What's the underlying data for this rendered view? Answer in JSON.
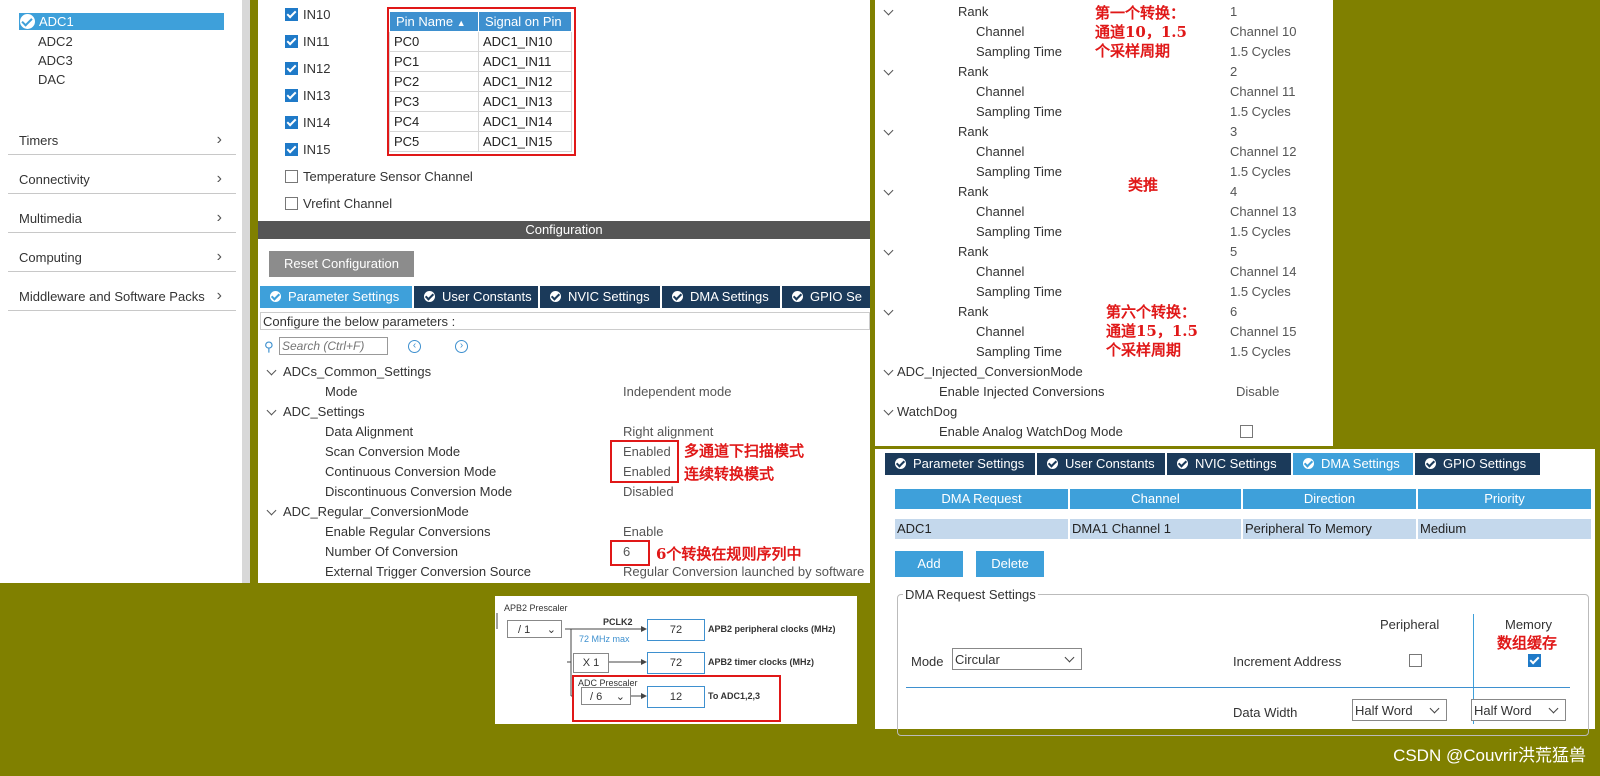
{
  "sidebar": {
    "adcs": [
      "ADC1",
      "ADC2",
      "ADC3",
      "DAC"
    ],
    "categories": [
      "Timers",
      "Connectivity",
      "Multimedia",
      "Computing",
      "Middleware and Software Packs"
    ]
  },
  "pins": {
    "channels": [
      "IN10",
      "IN11",
      "IN12",
      "IN13",
      "IN14",
      "IN15"
    ],
    "extra": [
      "Temperature Sensor Channel",
      "Vrefint Channel"
    ],
    "table_headers": [
      "Pin Name",
      "Signal on Pin"
    ],
    "rows": [
      [
        "PC0",
        "ADC1_IN10"
      ],
      [
        "PC1",
        "ADC1_IN11"
      ],
      [
        "PC2",
        "ADC1_IN12"
      ],
      [
        "PC3",
        "ADC1_IN13"
      ],
      [
        "PC4",
        "ADC1_IN14"
      ],
      [
        "PC5",
        "ADC1_IN15"
      ]
    ]
  },
  "config": {
    "bar_title": "Configuration",
    "reset_label": "Reset Configuration",
    "tabs": [
      "Parameter Settings",
      "User Constants",
      "NVIC Settings",
      "DMA Settings",
      "GPIO Se"
    ],
    "hint": "Configure the below parameters :",
    "search_placeholder": "Search (Ctrl+F)",
    "sections": [
      {
        "title": "ADCs_Common_Settings",
        "rows": [
          [
            "Mode",
            "Independent mode"
          ]
        ]
      },
      {
        "title": "ADC_Settings",
        "rows": [
          [
            "Data Alignment",
            "Right alignment"
          ],
          [
            "Scan Conversion Mode",
            "Enabled"
          ],
          [
            "Continuous Conversion Mode",
            "Enabled"
          ],
          [
            "Discontinuous Conversion Mode",
            "Disabled"
          ]
        ]
      },
      {
        "title": "ADC_Regular_ConversionMode",
        "rows": [
          [
            "Enable Regular Conversions",
            "Enable"
          ],
          [
            "Number Of Conversion",
            "6"
          ],
          [
            "External Trigger Conversion Source",
            "Regular Conversion launched by software"
          ]
        ]
      }
    ],
    "notes": {
      "scan": "多通道下扫描模式",
      "cont": "连续转换模式",
      "num": "6个转换在规则序列中"
    }
  },
  "clock": {
    "apb2_prescaler_label": "APB2 Prescaler",
    "apb2_prescaler": "/ 1",
    "pclk2": "PCLK2",
    "max_note": "72 MHz max",
    "periph_val": "72",
    "periph_label": "APB2 peripheral clocks (MHz)",
    "x1": "X 1",
    "timer_val": "72",
    "timer_label": "APB2 timer clocks (MHz)",
    "adc_prescaler_label": "ADC Prescaler",
    "adc_prescaler": "/ 6",
    "adc_val": "12",
    "adc_label": "To ADC1,2,3"
  },
  "ranks": {
    "items": [
      {
        "rank": "1",
        "channel": "Channel 10",
        "sampling": "1.5 Cycles"
      },
      {
        "rank": "2",
        "channel": "Channel 11",
        "sampling": "1.5 Cycles"
      },
      {
        "rank": "3",
        "channel": "Channel 12",
        "sampling": "1.5 Cycles"
      },
      {
        "rank": "4",
        "channel": "Channel 13",
        "sampling": "1.5 Cycles"
      },
      {
        "rank": "5",
        "channel": "Channel 14",
        "sampling": "1.5 Cycles"
      },
      {
        "rank": "6",
        "channel": "Channel 15",
        "sampling": "1.5 Cycles"
      }
    ],
    "labels": {
      "rank": "Rank",
      "channel": "Channel",
      "sampling": "Sampling Time"
    },
    "injected_title": "ADC_Injected_ConversionMode",
    "injected_row": [
      "Enable Injected Conversions",
      "Disable"
    ],
    "watchdog_title": "WatchDog",
    "watchdog_row": "Enable Analog WatchDog Mode",
    "notes": {
      "first": [
        "第一个转换：",
        "通道10，1.5",
        "个采样周期"
      ],
      "etc": "类推",
      "sixth": [
        "第六个转换：",
        "通道15，1.5",
        "个采样周期"
      ]
    }
  },
  "dma": {
    "tabs": [
      "Parameter Settings",
      "User Constants",
      "NVIC Settings",
      "DMA Settings",
      "GPIO Settings"
    ],
    "headers": [
      "DMA Request",
      "Channel",
      "Direction",
      "Priority"
    ],
    "row": [
      "ADC1",
      "DMA1 Channel 1",
      "Peripheral To Memory",
      "Medium"
    ],
    "add": "Add",
    "delete": "Delete",
    "settings_title": "DMA Request Settings",
    "peripheral": "Peripheral",
    "memory": "Memory",
    "memory_note": "数组缓存",
    "mode_label": "Mode",
    "mode_value": "Circular",
    "increment_label": "Increment Address",
    "data_width_label": "Data Width",
    "periph_width": "Half Word",
    "mem_width": "Half Word"
  },
  "watermark": "CSDN @Couvrir洪荒猛兽"
}
